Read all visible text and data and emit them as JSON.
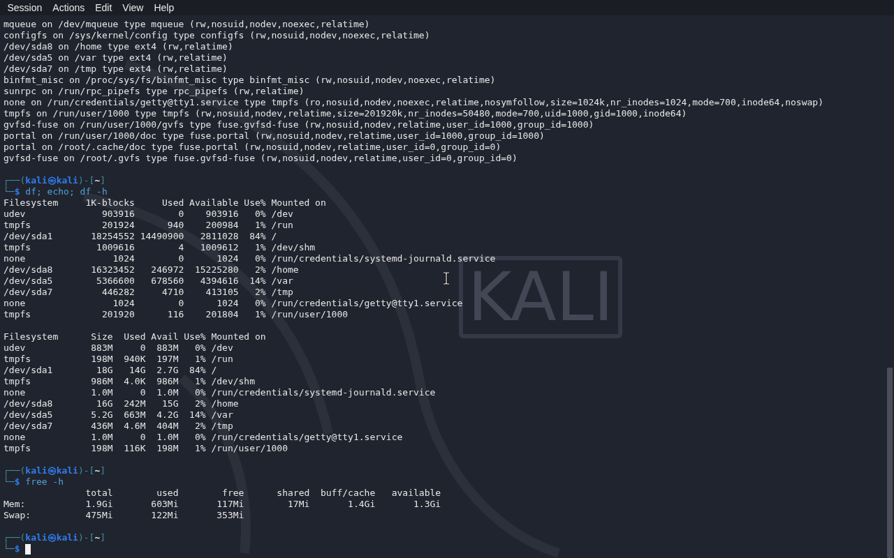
{
  "menu_bar": {
    "items": [
      "Session",
      "Actions",
      "Edit",
      "View",
      "Help"
    ]
  },
  "wallpaper": {
    "logo_text": "KALI"
  },
  "terminal": {
    "lines": [
      {
        "kind": "text",
        "text": "mqueue on /dev/mqueue type mqueue (rw,nosuid,nodev,noexec,relatime)"
      },
      {
        "kind": "text",
        "text": "configfs on /sys/kernel/config type configfs (rw,nosuid,nodev,noexec,relatime)"
      },
      {
        "kind": "text",
        "text": "/dev/sda8 on /home type ext4 (rw,relatime)"
      },
      {
        "kind": "text",
        "text": "/dev/sda5 on /var type ext4 (rw,relatime)"
      },
      {
        "kind": "text",
        "text": "/dev/sda7 on /tmp type ext4 (rw,relatime)"
      },
      {
        "kind": "text",
        "text": "binfmt_misc on /proc/sys/fs/binfmt_misc type binfmt_misc (rw,nosuid,nodev,noexec,relatime)"
      },
      {
        "kind": "text",
        "text": "sunrpc on /run/rpc_pipefs type rpc_pipefs (rw,relatime)"
      },
      {
        "kind": "text",
        "text": "none on /run/credentials/getty@tty1.service type tmpfs (ro,nosuid,nodev,noexec,relatime,nosymfollow,size=1024k,nr_inodes=1024,mode=700,inode64,noswap)"
      },
      {
        "kind": "text",
        "text": "tmpfs on /run/user/1000 type tmpfs (rw,nosuid,nodev,relatime,size=201920k,nr_inodes=50480,mode=700,uid=1000,gid=1000,inode64)"
      },
      {
        "kind": "text",
        "text": "gvfsd-fuse on /run/user/1000/gvfs type fuse.gvfsd-fuse (rw,nosuid,nodev,relatime,user_id=1000,group_id=1000)"
      },
      {
        "kind": "text",
        "text": "portal on /run/user/1000/doc type fuse.portal (rw,nosuid,nodev,relatime,user_id=1000,group_id=1000)"
      },
      {
        "kind": "text",
        "text": "portal on /root/.cache/doc type fuse.portal (rw,nosuid,nodev,relatime,user_id=0,group_id=0)"
      },
      {
        "kind": "text",
        "text": "gvfsd-fuse on /root/.gvfs type fuse.gvfsd-fuse (rw,nosuid,nodev,relatime,user_id=0,group_id=0)"
      },
      {
        "kind": "blank"
      },
      {
        "kind": "prompt",
        "open": "┌──(",
        "user": "kali",
        "at": "㉿",
        "host": "kali",
        "mid": ")-[",
        "dir": "~",
        "close": "]",
        "corner": "└─",
        "sign": "$",
        "command": "df; echo; df -h",
        "cursor": false
      },
      {
        "kind": "text",
        "text": "Filesystem     1K-blocks     Used Available Use% Mounted on"
      },
      {
        "kind": "text",
        "text": "udev              903916        0    903916   0% /dev"
      },
      {
        "kind": "text",
        "text": "tmpfs             201924      940    200984   1% /run"
      },
      {
        "kind": "text",
        "text": "/dev/sda1       18254552 14490900   2811028  84% /"
      },
      {
        "kind": "text",
        "text": "tmpfs            1009616        4   1009612   1% /dev/shm"
      },
      {
        "kind": "text",
        "text": "none                1024        0      1024   0% /run/credentials/systemd-journald.service"
      },
      {
        "kind": "text",
        "text": "/dev/sda8       16323452   246972  15225280   2% /home"
      },
      {
        "kind": "text",
        "text": "/dev/sda5        5366600   678560   4394616  14% /var"
      },
      {
        "kind": "text",
        "text": "/dev/sda7         446282     4710    413105   2% /tmp"
      },
      {
        "kind": "text",
        "text": "none                1024        0      1024   0% /run/credentials/getty@tty1.service"
      },
      {
        "kind": "text",
        "text": "tmpfs             201920      116    201804   1% /run/user/1000"
      },
      {
        "kind": "blank"
      },
      {
        "kind": "text",
        "text": "Filesystem      Size  Used Avail Use% Mounted on"
      },
      {
        "kind": "text",
        "text": "udev            883M     0  883M   0% /dev"
      },
      {
        "kind": "text",
        "text": "tmpfs           198M  940K  197M   1% /run"
      },
      {
        "kind": "text",
        "text": "/dev/sda1        18G   14G  2.7G  84% /"
      },
      {
        "kind": "text",
        "text": "tmpfs           986M  4.0K  986M   1% /dev/shm"
      },
      {
        "kind": "text",
        "text": "none            1.0M     0  1.0M   0% /run/credentials/systemd-journald.service"
      },
      {
        "kind": "text",
        "text": "/dev/sda8        16G  242M   15G   2% /home"
      },
      {
        "kind": "text",
        "text": "/dev/sda5       5.2G  663M  4.2G  14% /var"
      },
      {
        "kind": "text",
        "text": "/dev/sda7       436M  4.6M  404M   2% /tmp"
      },
      {
        "kind": "text",
        "text": "none            1.0M     0  1.0M   0% /run/credentials/getty@tty1.service"
      },
      {
        "kind": "text",
        "text": "tmpfs           198M  116K  198M   1% /run/user/1000"
      },
      {
        "kind": "blank"
      },
      {
        "kind": "prompt",
        "open": "┌──(",
        "user": "kali",
        "at": "㉿",
        "host": "kali",
        "mid": ")-[",
        "dir": "~",
        "close": "]",
        "corner": "└─",
        "sign": "$",
        "command": "free -h",
        "cursor": false
      },
      {
        "kind": "text",
        "text": "               total        used        free      shared  buff/cache   available"
      },
      {
        "kind": "text",
        "text": "Mem:           1.9Gi       603Mi       117Mi        17Mi       1.4Gi       1.3Gi"
      },
      {
        "kind": "text",
        "text": "Swap:          475Mi       122Mi       353Mi"
      },
      {
        "kind": "blank"
      },
      {
        "kind": "prompt",
        "open": "┌──(",
        "user": "kali",
        "at": "㉿",
        "host": "kali",
        "mid": ")-[",
        "dir": "~",
        "close": "]",
        "corner": "└─",
        "sign": "$",
        "cursor": true
      }
    ]
  }
}
